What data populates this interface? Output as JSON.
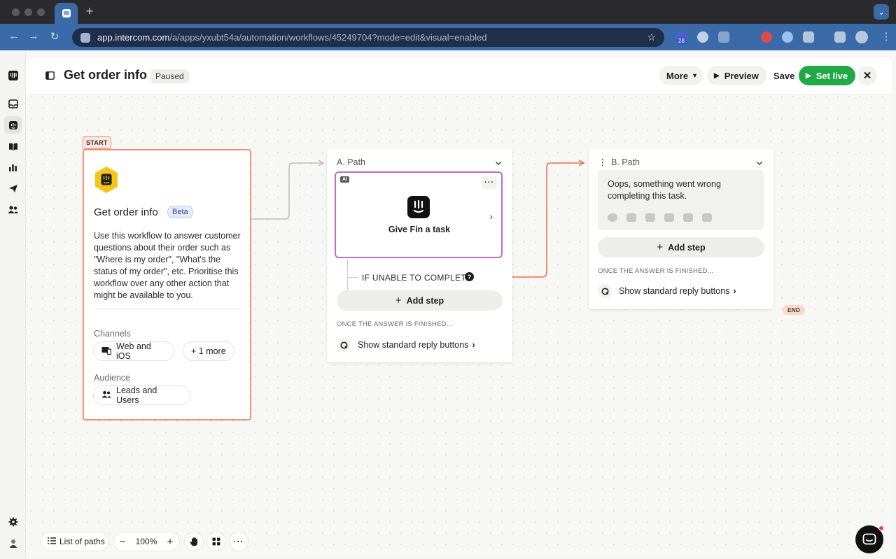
{
  "browser": {
    "url_host": "app.intercom.com",
    "url_path": "/a/apps/yxubt54a/automation/workflows/45249704?mode=edit&visual=enabled",
    "extension_badge": "28",
    "colors": {
      "chrome": "#2b2b2d",
      "toolbar": "#3a6aa8"
    }
  },
  "header": {
    "title": "Get order info",
    "status": "Paused",
    "more_label": "More",
    "preview_label": "Preview",
    "save_label": "Save",
    "set_live_label": "Set live"
  },
  "start_card": {
    "tag": "START",
    "title": "Get order info",
    "badge": "Beta",
    "description": "Use this workflow to answer customer questions about their order such as \"Where is my order\", \"What's the status of my order\", etc. Prioritise this workflow over any other action that might be available to you.",
    "channels_label": "Channels",
    "channel_primary": "Web and iOS",
    "channel_more": "+ 1 more",
    "audience_label": "Audience",
    "audience_value": "Leads and Users"
  },
  "path_a": {
    "title": "A. Path",
    "ai_badge": "AI",
    "task_label": "Give Fin a task",
    "unable_label": "IF UNABLE TO COMPLETE",
    "add_step": "Add step",
    "once_label": "ONCE THE ANSWER IS FINISHED...",
    "reply_label": "Show standard reply buttons"
  },
  "path_b": {
    "title": "B. Path",
    "message": "Oops, something went wrong completing this task.",
    "add_step": "Add step",
    "once_label": "ONCE THE ANSWER IS FINISHED...",
    "reply_label": "Show standard reply buttons",
    "end_tag": "END"
  },
  "toolbar": {
    "list_of_paths": "List of paths",
    "zoom": "100%"
  },
  "colors": {
    "accent_green": "#23a846",
    "start_border": "#f0916f",
    "fin_task_border": "#c46bc0",
    "fin_yellow": "#f5c518",
    "edge_orange": "#ec6f45"
  }
}
